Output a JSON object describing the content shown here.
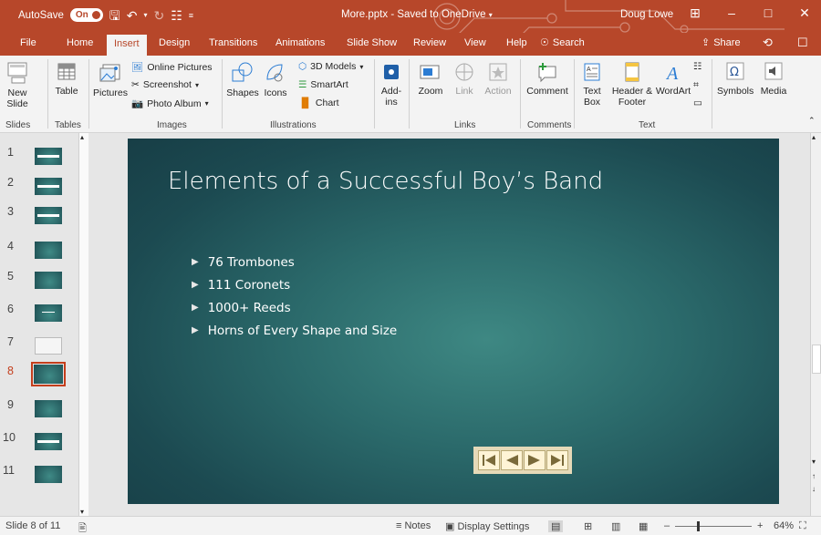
{
  "titlebar": {
    "autosave_label": "AutoSave",
    "autosave_state": "On",
    "document_title": "More.pptx - Saved to OneDrive",
    "user": "Doug Lowe",
    "accent_color": "#b7472a"
  },
  "tabs": [
    "File",
    "Home",
    "Insert",
    "Design",
    "Transitions",
    "Animations",
    "Slide Show",
    "Review",
    "View",
    "Help"
  ],
  "active_tab": "Insert",
  "search_label": "Search",
  "share_label": "Share",
  "ribbon": {
    "slides": {
      "new_slide": "New Slide",
      "group": "Slides"
    },
    "tables": {
      "table": "Table",
      "group": "Tables"
    },
    "images": {
      "pictures": "Pictures",
      "online_pictures": "Online Pictures",
      "screenshot": "Screenshot",
      "photo_album": "Photo Album",
      "group": "Images"
    },
    "illustrations": {
      "shapes": "Shapes",
      "icons": "Icons",
      "models3d": "3D Models",
      "smartart": "SmartArt",
      "chart": "Chart",
      "group": "Illustrations"
    },
    "addins": {
      "addins": "Add-ins"
    },
    "links": {
      "zoom": "Zoom",
      "link": "Link",
      "action": "Action",
      "group": "Links"
    },
    "comments": {
      "comment": "Comment",
      "group": "Comments"
    },
    "text": {
      "textbox": "Text Box",
      "header_footer": "Header & Footer",
      "wordart": "WordArt",
      "group": "Text"
    },
    "symbols": {
      "symbols": "Symbols"
    },
    "media": {
      "media": "Media"
    }
  },
  "thumbnails": [
    "1",
    "2",
    "3",
    "4",
    "5",
    "6",
    "7",
    "8",
    "9",
    "10",
    "11"
  ],
  "active_slide": "8",
  "slide": {
    "title": "Elements of a Successful Boy’s Band",
    "bullets": [
      "76 Trombones",
      "111 Coronets",
      "1000+ Reeds",
      "Horns of Every Shape and Size"
    ]
  },
  "status": {
    "slide_counter": "Slide 8 of 11",
    "notes": "Notes",
    "display_settings": "Display Settings",
    "zoom_level": "64%"
  }
}
